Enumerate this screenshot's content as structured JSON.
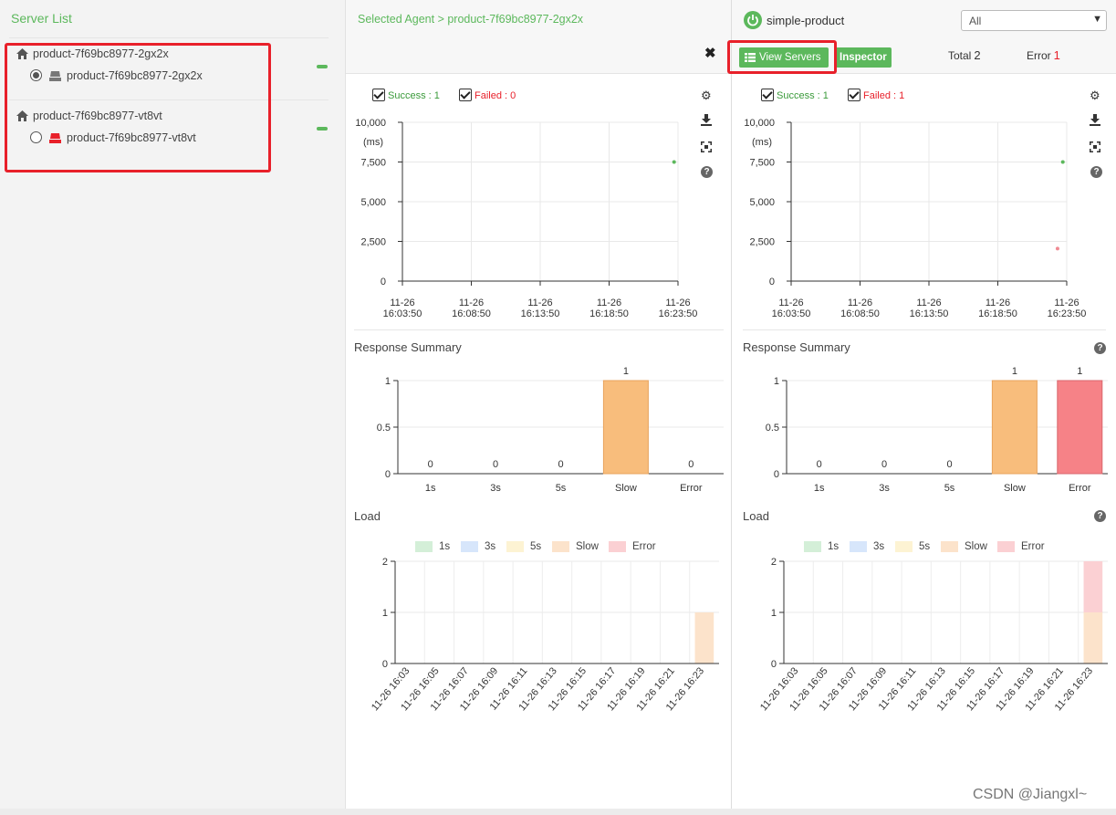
{
  "sidebar": {
    "title": "Server List",
    "groups": [
      {
        "host": "product-7f69bc8977-2gx2x",
        "server": "product-7f69bc8977-2gx2x",
        "selected": true,
        "status_color": "#777777"
      },
      {
        "host": "product-7f69bc8977-vt8vt",
        "server": "product-7f69bc8977-vt8vt",
        "selected": false,
        "status_color": "#e8202a"
      }
    ]
  },
  "agent_panel": {
    "breadcrumb": "Selected Agent > product-7f69bc8977-2gx2x",
    "close_glyph": "✖",
    "legend": {
      "success": "Success : 1",
      "failed": "Failed : 0"
    },
    "scatter": {
      "ylabel": "(ms)",
      "yticks": [
        "10,000",
        "7,500",
        "5,000",
        "2,500",
        "0"
      ],
      "xticks": [
        [
          "11-26",
          "16:03:50"
        ],
        [
          "11-26",
          "16:08:50"
        ],
        [
          "11-26",
          "16:13:50"
        ],
        [
          "11-26",
          "16:18:50"
        ],
        [
          "11-26",
          "16:23:50"
        ]
      ]
    },
    "response_title": "Response Summary",
    "load_title": "Load"
  },
  "app_panel": {
    "app_name": "simple-product",
    "filter_value": "All",
    "view_servers_label": "View Servers",
    "inspector_label": "Inspector",
    "total_label": "Total",
    "total_value": "2",
    "error_label": "Error",
    "error_value": "1",
    "legend": {
      "success": "Success : 1",
      "failed": "Failed : 1"
    },
    "response_title": "Response Summary",
    "load_title": "Load"
  },
  "watermark": "CSDN @Jiangxl~",
  "colors": {
    "green": "#5cb85c",
    "red": "#e8202a",
    "slow": "#f8bd7c",
    "error": "#f68287"
  },
  "chart_data": [
    {
      "name": "agent-response-time",
      "type": "scatter",
      "ylim": [
        0,
        10000
      ],
      "ylabel": "(ms)",
      "series": [
        {
          "name": "Success",
          "color": "#5cb85c",
          "points": [
            {
              "x": "11-26 16:23:33",
              "y": 7500
            }
          ]
        }
      ]
    },
    {
      "name": "agent-response-summary",
      "type": "bar",
      "categories": [
        "1s",
        "3s",
        "5s",
        "Slow",
        "Error"
      ],
      "values": [
        0,
        0,
        0,
        1,
        0
      ],
      "ylim": [
        0,
        1
      ],
      "yticks": [
        "1",
        "0.5",
        "0"
      ]
    },
    {
      "name": "agent-load",
      "type": "bar",
      "stacked": true,
      "ylim": [
        0,
        2
      ],
      "yticks": [
        "2",
        "1",
        "0"
      ],
      "legend": [
        "1s",
        "3s",
        "5s",
        "Slow",
        "Error"
      ],
      "categories": [
        "11-26 16:03",
        "11-26 16:05",
        "11-26 16:07",
        "11-26 16:09",
        "11-26 16:11",
        "11-26 16:13",
        "11-26 16:15",
        "11-26 16:17",
        "11-26 16:19",
        "11-26 16:21",
        "11-26 16:23"
      ],
      "series": [
        {
          "name": "Slow",
          "values": [
            0,
            0,
            0,
            0,
            0,
            0,
            0,
            0,
            0,
            0,
            1
          ]
        },
        {
          "name": "Error",
          "values": [
            0,
            0,
            0,
            0,
            0,
            0,
            0,
            0,
            0,
            0,
            0
          ]
        }
      ]
    },
    {
      "name": "app-response-time",
      "type": "scatter",
      "ylim": [
        0,
        10000
      ],
      "ylabel": "(ms)",
      "series": [
        {
          "name": "Success",
          "color": "#5cb85c",
          "points": [
            {
              "x": "11-26 16:23:33",
              "y": 7500
            }
          ]
        },
        {
          "name": "Failed",
          "color": "#f08a93",
          "points": [
            {
              "x": "11-26 16:23:10",
              "y": 2050
            }
          ]
        }
      ]
    },
    {
      "name": "app-response-summary",
      "type": "bar",
      "categories": [
        "1s",
        "3s",
        "5s",
        "Slow",
        "Error"
      ],
      "values": [
        0,
        0,
        0,
        1,
        1
      ],
      "ylim": [
        0,
        1
      ],
      "yticks": [
        "1",
        "0.5",
        "0"
      ]
    },
    {
      "name": "app-load",
      "type": "bar",
      "stacked": true,
      "ylim": [
        0,
        2
      ],
      "yticks": [
        "2",
        "1",
        "0"
      ],
      "legend": [
        "1s",
        "3s",
        "5s",
        "Slow",
        "Error"
      ],
      "categories": [
        "11-26 16:03",
        "11-26 16:05",
        "11-26 16:07",
        "11-26 16:09",
        "11-26 16:11",
        "11-26 16:13",
        "11-26 16:15",
        "11-26 16:17",
        "11-26 16:19",
        "11-26 16:21",
        "11-26 16:23"
      ],
      "series": [
        {
          "name": "Slow",
          "values": [
            0,
            0,
            0,
            0,
            0,
            0,
            0,
            0,
            0,
            0,
            1
          ]
        },
        {
          "name": "Error",
          "values": [
            0,
            0,
            0,
            0,
            0,
            0,
            0,
            0,
            0,
            0,
            1
          ]
        }
      ]
    }
  ]
}
